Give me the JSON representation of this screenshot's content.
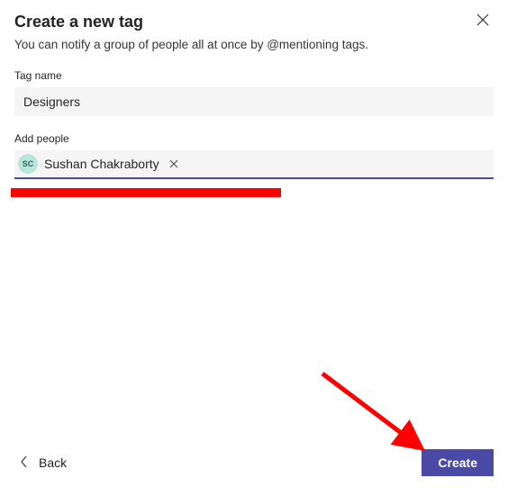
{
  "modal": {
    "title": "Create a new tag",
    "subtitle": "You can notify a group of people all at once by @mentioning tags."
  },
  "tagName": {
    "label": "Tag name",
    "value": "Designers"
  },
  "addPeople": {
    "label": "Add people",
    "chip": {
      "initials": "SC",
      "name": "Sushan Chakraborty"
    }
  },
  "footer": {
    "backLabel": "Back",
    "createLabel": "Create"
  }
}
